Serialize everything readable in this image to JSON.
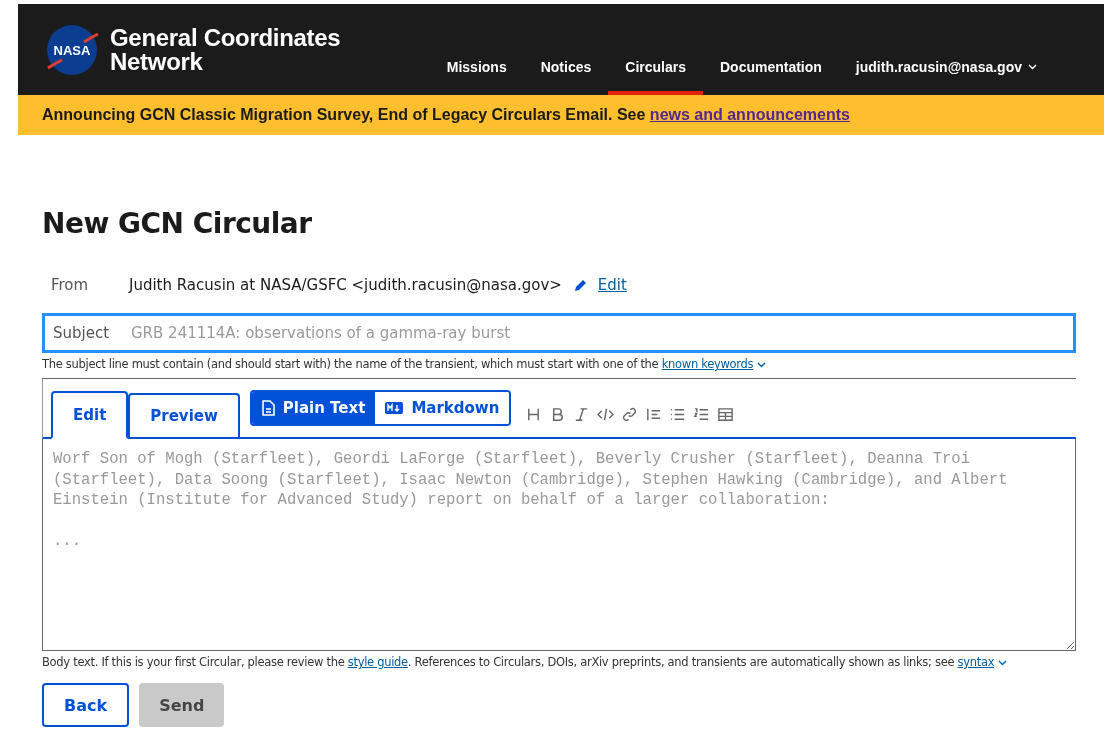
{
  "header": {
    "title_line_1": "General Coordinates",
    "title_line_2": "Network",
    "logo_text": "NASA",
    "nav": [
      {
        "label": "Missions",
        "selected": false
      },
      {
        "label": "Notices",
        "selected": false
      },
      {
        "label": "Circulars",
        "selected": true
      },
      {
        "label": "Documentation",
        "selected": false
      }
    ],
    "user_menu": "judith.racusin@nasa.gov"
  },
  "banner": {
    "text": "Announcing GCN Classic Migration Survey, End of Legacy Circulars Email. See ",
    "link": "news and announcements"
  },
  "page_title": "New GCN Circular",
  "from": {
    "label": "From",
    "value": "Judith Racusin at NASA/GSFC <judith.racusin@nasa.gov>",
    "edit_link": "Edit"
  },
  "subject": {
    "label": "Subject",
    "placeholder": "GRB 241114A: observations of a gamma-ray burst",
    "hint": "The subject line must contain (and should start with) the name of the transient, which must start with one of the ",
    "hint_link": "known keywords"
  },
  "editor_tabs": [
    {
      "label": "Edit",
      "selected": true
    },
    {
      "label": "Preview",
      "selected": false
    }
  ],
  "format_toggle": [
    {
      "label": "Plain Text",
      "kind": "text",
      "selected": true
    },
    {
      "label": "Markdown",
      "kind": "markdown",
      "selected": false
    }
  ],
  "body": {
    "placeholder": "Worf Son of Mogh (Starfleet), Geordi LaForge (Starfleet), Beverly Crusher (Starfleet), Deanna Troi\n(Starfleet), Data Soong (Starfleet), Isaac Newton (Cambridge), Stephen Hawking (Cambridge), and Albert\nEinstein (Institute for Advanced Study) report on behalf of a larger collaboration:\n\n...",
    "hint_1": "Body text. If this is your first Circular, please review the ",
    "hint_link_1": "style guide",
    "hint_2": ". References to Circulars, DOIs, arXiv preprints, and transients are automatically shown as links; see ",
    "hint_link_2": "syntax"
  },
  "buttons": [
    {
      "label": "Back",
      "disabled": false
    },
    {
      "label": "Send",
      "disabled": true
    }
  ]
}
